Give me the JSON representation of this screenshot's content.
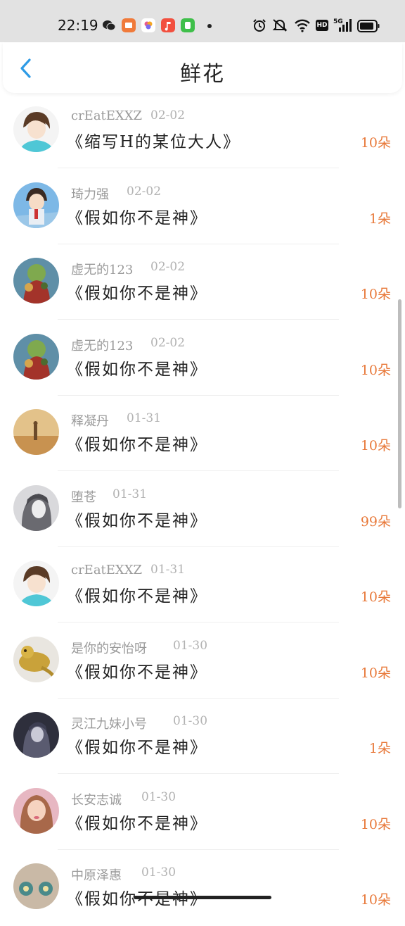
{
  "status_bar": {
    "time": "22:19",
    "notification_icons": [
      "wechat-icon",
      "orange-app-icon",
      "gallery-app-icon",
      "music-app-icon",
      "green-app-icon",
      "more-dot-icon"
    ],
    "system_icons": [
      "alarm-icon",
      "mute-icon",
      "wifi-icon",
      "hd-icon",
      "5g-signal-icon",
      "battery-icon"
    ],
    "signal_label": "5G",
    "hd_label": "HD"
  },
  "header": {
    "title": "鲜花",
    "back_icon": "chevron-left-icon",
    "accent_color": "#2e9be6"
  },
  "colors": {
    "flowers_text": "#e8793a",
    "name_text": "#9a9a9a",
    "date_text": "#b2b2b2"
  },
  "items": [
    {
      "name": "crEatEXXZ",
      "date": "02-02",
      "work": "《缩写H的某位大人》",
      "flowers": "10朵"
    },
    {
      "name": "琦力强",
      "date": "02-02",
      "work": "《假如你不是神》",
      "flowers": "1朵"
    },
    {
      "name": "虚无的123",
      "date": "02-02",
      "work": "《假如你不是神》",
      "flowers": "10朵"
    },
    {
      "name": "虚无的123",
      "date": "02-02",
      "work": "《假如你不是神》",
      "flowers": "10朵"
    },
    {
      "name": "释凝丹",
      "date": "01-31",
      "work": "《假如你不是神》",
      "flowers": "10朵"
    },
    {
      "name": "堕苍",
      "date": "01-31",
      "work": "《假如你不是神》",
      "flowers": "99朵"
    },
    {
      "name": "crEatEXXZ",
      "date": "01-31",
      "work": "《假如你不是神》",
      "flowers": "10朵"
    },
    {
      "name": "是你的安怡呀",
      "date": "01-30",
      "work": "《假如你不是神》",
      "flowers": "10朵"
    },
    {
      "name": "灵江九妹小号",
      "date": "01-30",
      "work": "《假如你不是神》",
      "flowers": "1朵"
    },
    {
      "name": "长安志诚",
      "date": "01-30",
      "work": "《假如你不是神》",
      "flowers": "10朵"
    },
    {
      "name": "中原泽惠",
      "date": "01-30",
      "work": "《假如你不是神》",
      "flowers": "10朵"
    }
  ]
}
